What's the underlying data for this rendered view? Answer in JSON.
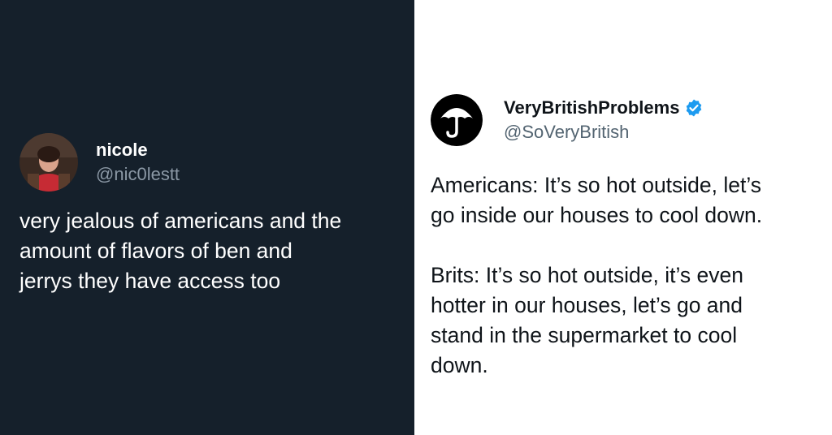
{
  "left_tweet": {
    "display_name": "nicole",
    "handle": "@nic0lestt",
    "text": "very jealous of americans and the\namount of flavors of ben and\njerrys they have access too",
    "colors": {
      "background": "#15202b",
      "text": "#ffffff",
      "handle": "#8b98a5"
    }
  },
  "right_tweet": {
    "display_name": "VeryBritishProblems",
    "handle": "@SoVeryBritish",
    "verified": true,
    "paragraph_1": "Americans: It’s so hot outside, let’s\ngo inside our houses to cool down.",
    "paragraph_2": "Brits: It’s so hot outside, it’s even\nhotter in our houses, let’s go and\nstand in the supermarket to cool\ndown.",
    "colors": {
      "background": "#ffffff",
      "text": "#0f1419",
      "handle": "#536471",
      "verified": "#1d9bf0"
    }
  }
}
